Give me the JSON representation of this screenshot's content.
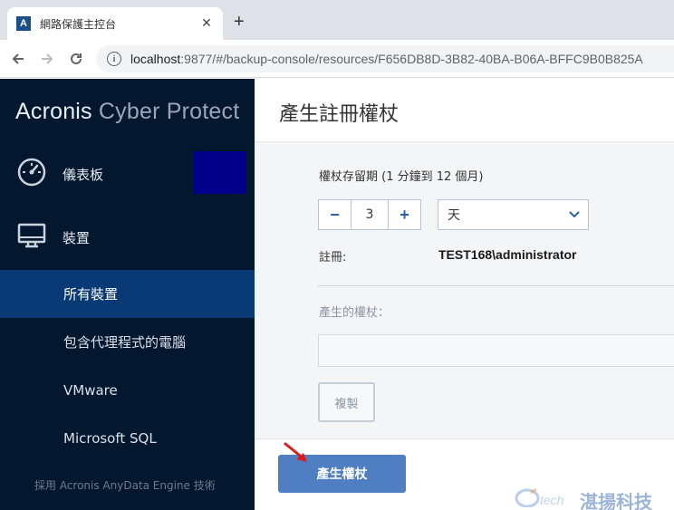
{
  "browser": {
    "tab_title": "網路保護主控台",
    "tab_favicon": "A",
    "url_host": "localhost",
    "url_path": ":9877/#/backup-console/resources/F656DB8D-3B82-40BA-B06A-BFFC9B0B825A"
  },
  "sidebar": {
    "brand_acronis": "Acronis",
    "brand_product": " Cyber Protect",
    "main_items": [
      {
        "label": "儀表板",
        "icon": "dashboard-gauge-icon"
      },
      {
        "label": "裝置",
        "icon": "monitor-icon"
      }
    ],
    "sub_items": [
      {
        "label": "所有裝置",
        "active": true
      },
      {
        "label": "包含代理程式的電腦",
        "active": false
      },
      {
        "label": "VMware",
        "active": false
      },
      {
        "label": "Microsoft SQL",
        "active": false
      }
    ],
    "footer_note": "採用 Acronis AnyData Engine 技術"
  },
  "panel": {
    "title": "產生註冊權杖",
    "lifetime_label": "權杖存留期 (1 分鐘到 12 個月)",
    "stepper_value": "3",
    "unit_value": "天",
    "registration_label": "註冊:",
    "registration_value": "TEST168\\administrator",
    "token_label": "產生的權杖：",
    "token_value": "",
    "copy_button": "複製",
    "generate_button": "產生權杖"
  },
  "watermark": {
    "tech": "tech",
    "cn": "湛揚科技"
  },
  "colors": {
    "sidebar_bg": "#03172f",
    "active_item": "#0a3a75",
    "primary_button": "#4f7fc2"
  }
}
